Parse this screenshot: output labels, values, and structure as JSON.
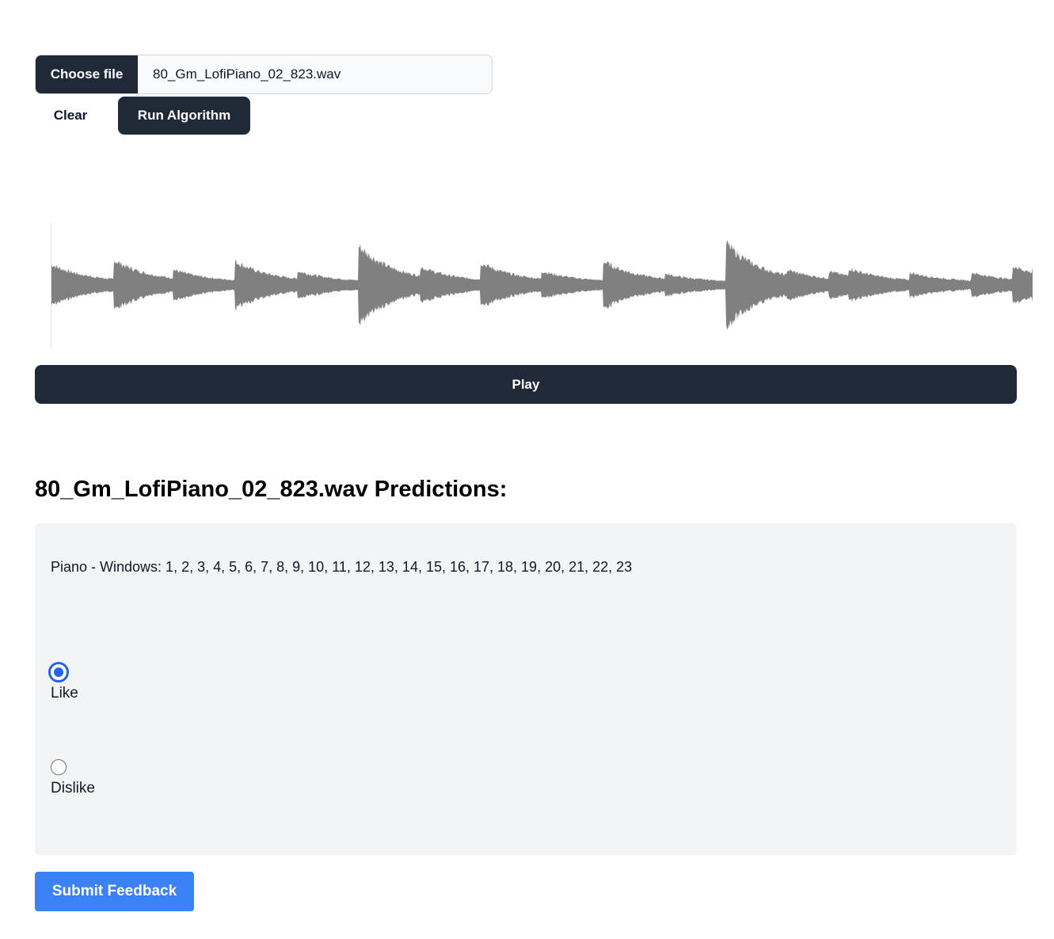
{
  "uploader": {
    "choose_label": "Choose file",
    "file_name": "80_Gm_LofiPiano_02_823.wav",
    "clear_label": "Clear",
    "run_label": "Run Algorithm"
  },
  "player": {
    "play_label": "Play",
    "waveform_color": "#808080"
  },
  "predictions": {
    "title": "80_Gm_LofiPiano_02_823.wav Predictions:",
    "text": "Piano - Windows: 1, 2, 3, 4, 5, 6, 7, 8, 9, 10, 11, 12, 13, 14, 15, 16, 17, 18, 19, 20, 21, 22, 23"
  },
  "feedback": {
    "like_label": "Like",
    "dislike_label": "Dislike",
    "selected": "Like",
    "submit_label": "Submit Feedback"
  },
  "colors": {
    "dark_button": "#1f2937",
    "accent": "#3b82f6",
    "radio_checked": "#2563eb",
    "panel_bg": "#f3f4f6"
  }
}
